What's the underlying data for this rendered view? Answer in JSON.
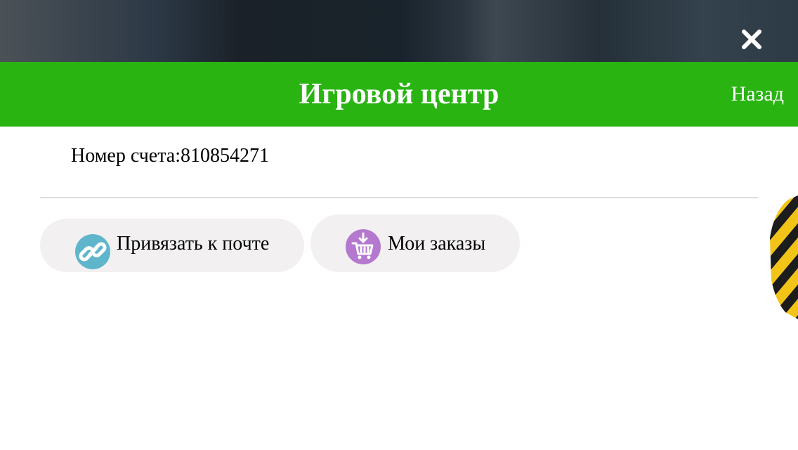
{
  "window": {
    "close_icon": "close-icon"
  },
  "header": {
    "title": "Игровой центр",
    "back_label": "Назад",
    "background_color": "#29b412"
  },
  "account": {
    "label": "Номер счета:",
    "number": "810854271"
  },
  "actions": [
    {
      "label": "Привязать к почте",
      "icon": "link-icon",
      "icon_color": "#5fb6cb"
    },
    {
      "label": "Мои заказы",
      "icon": "cart-download-icon",
      "icon_color": "#b478cf"
    }
  ]
}
